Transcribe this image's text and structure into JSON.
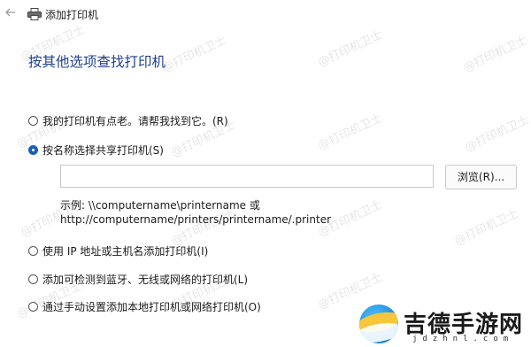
{
  "window": {
    "title": "添加打印机"
  },
  "heading": "按其他选项查找打印机",
  "options": [
    {
      "label": "我的打印机有点老。请帮我找到它。(R)",
      "selected": false
    },
    {
      "label": "按名称选择共享打印机(S)",
      "selected": true
    },
    {
      "label": "使用 IP 地址或主机名添加打印机(I)",
      "selected": false
    },
    {
      "label": "添加可检测到蓝牙、无线或网络的打印机(L)",
      "selected": false
    },
    {
      "label": "通过手动设置添加本地打印机或网络打印机(O)",
      "selected": false
    }
  ],
  "shared_printer": {
    "input_value": "",
    "browse_label": "浏览(R)...",
    "example_line1": "示例: \\\\computername\\printername 或",
    "example_line2": "http://computername/printers/printername/.printer"
  },
  "watermark": "@打印机卫士",
  "logo": {
    "text": "吉德手游网",
    "sub": "jdzhnl.com"
  },
  "colors": {
    "heading": "#1f3f8f",
    "radio_selected": "#1a5fb4"
  }
}
